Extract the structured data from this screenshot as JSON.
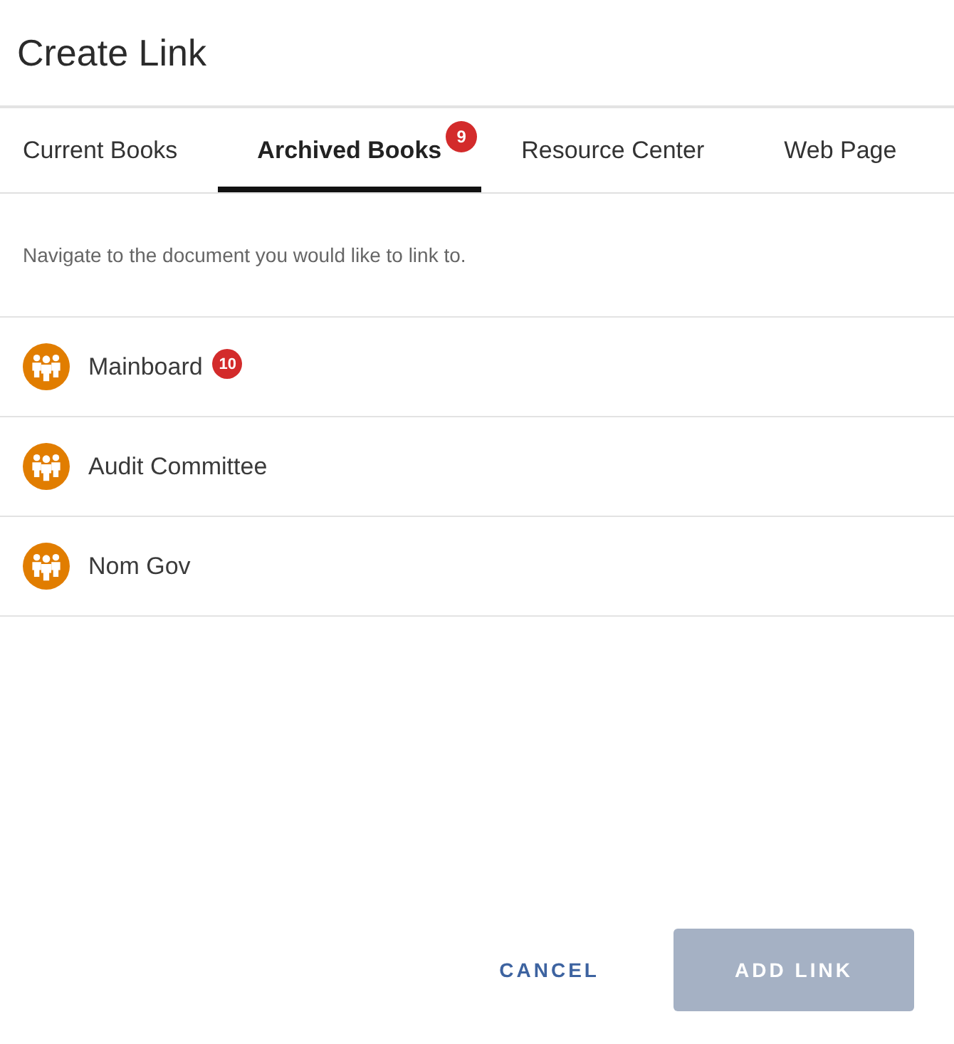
{
  "dialog": {
    "title": "Create Link"
  },
  "tabs": [
    {
      "label": "Current Books",
      "selected": false
    },
    {
      "label": "Archived Books",
      "selected": true,
      "badge": "9"
    },
    {
      "label": "Resource Center",
      "selected": false
    },
    {
      "label": "Web Page",
      "selected": false
    }
  ],
  "instruction": "Navigate to the document you would like to link to.",
  "items": [
    {
      "name": "Mainboard",
      "badge": "10"
    },
    {
      "name": "Audit Committee"
    },
    {
      "name": "Nom Gov"
    }
  ],
  "buttons": [
    {
      "label": "CANCEL",
      "kind": "text",
      "disabled": false
    },
    {
      "label": "ADD LINK",
      "kind": "primary",
      "disabled": true
    }
  ]
}
